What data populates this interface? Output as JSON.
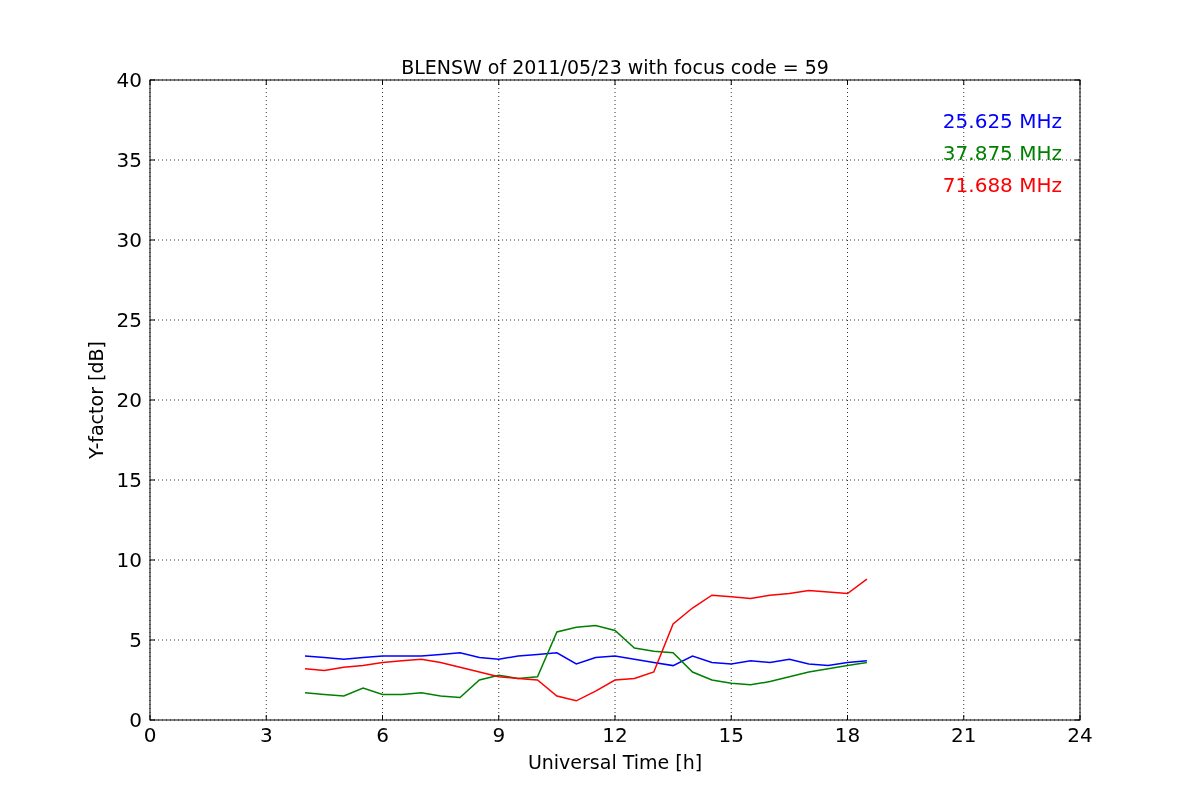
{
  "figure": {
    "chart_data": {
      "type": "line",
      "title": "BLENSW of 2011/05/23 with focus code = 59",
      "xlabel": "Universal Time [h]",
      "ylabel": "Y-factor [dB]",
      "x": [
        4,
        4.5,
        5,
        5.5,
        6,
        6.5,
        7,
        7.5,
        8,
        8.5,
        9,
        9.5,
        10,
        10.5,
        11,
        11.5,
        12,
        12.5,
        13,
        13.5,
        14,
        14.5,
        15,
        15.5,
        16,
        16.5,
        17,
        17.5,
        18,
        18.5
      ],
      "series": [
        {
          "name": "25.625 MHz",
          "color": "#0000ff",
          "values": [
            4.0,
            3.9,
            3.8,
            3.9,
            4.0,
            4.0,
            4.0,
            4.1,
            4.2,
            3.9,
            3.8,
            4.0,
            4.1,
            4.2,
            3.5,
            3.9,
            4.0,
            3.8,
            3.6,
            3.4,
            4.0,
            3.6,
            3.5,
            3.7,
            3.6,
            3.8,
            3.5,
            3.4,
            3.6,
            3.7
          ]
        },
        {
          "name": "37.875 MHz",
          "color": "#008000",
          "values": [
            1.7,
            1.6,
            1.5,
            2.0,
            1.6,
            1.6,
            1.7,
            1.5,
            1.4,
            2.5,
            2.8,
            2.6,
            2.7,
            5.5,
            5.8,
            5.9,
            5.6,
            4.5,
            4.3,
            4.2,
            3.0,
            2.5,
            2.3,
            2.2,
            2.4,
            2.7,
            3.0,
            3.2,
            3.4,
            3.6
          ]
        },
        {
          "name": "71.688 MHz",
          "color": "#ff0000",
          "values": [
            3.2,
            3.1,
            3.3,
            3.4,
            3.6,
            3.7,
            3.8,
            3.6,
            3.3,
            3.0,
            2.7,
            2.6,
            2.5,
            1.5,
            1.2,
            1.8,
            2.5,
            2.6,
            3.0,
            6.0,
            7.0,
            7.8,
            7.7,
            7.6,
            7.8,
            7.9,
            8.1,
            8.0,
            7.9,
            8.8
          ]
        }
      ],
      "grid": true,
      "xlim": [
        0,
        24
      ],
      "ylim": [
        0,
        40
      ],
      "xticks": [
        0,
        3,
        6,
        9,
        12,
        15,
        18,
        21,
        24
      ],
      "yticks": [
        0,
        5,
        10,
        15,
        20,
        25,
        30,
        35,
        40
      ]
    }
  }
}
